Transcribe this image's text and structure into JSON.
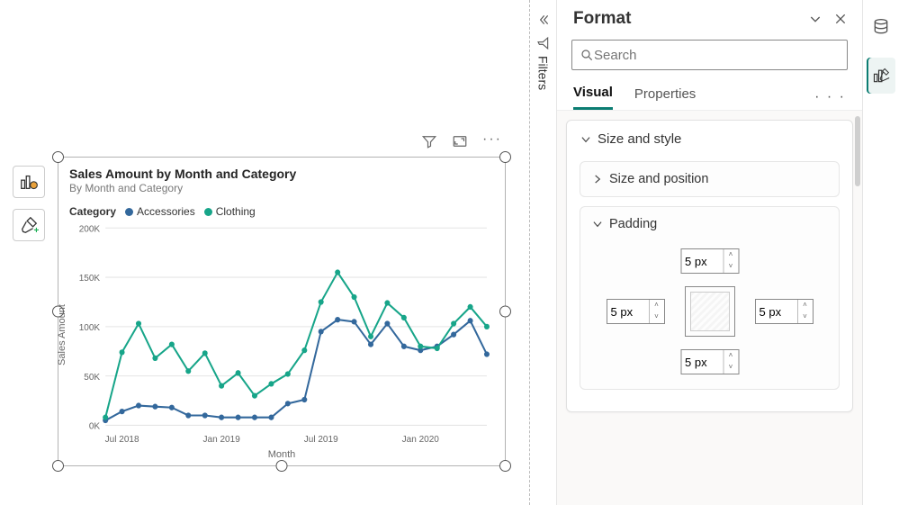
{
  "canvas": {
    "visual_toolbar": {
      "filter": "filter-icon",
      "focus": "focus-mode-icon",
      "more": "···"
    },
    "left_tools": {
      "chart_btn": "column-chart-icon",
      "format_btn": "format-paint-icon"
    }
  },
  "chart": {
    "title": "Sales Amount by Month and Category",
    "subtitle": "By Month and Category",
    "legend_label": "Category",
    "xlabel": "Month",
    "ylabel": "Sales Amount"
  },
  "chart_data": {
    "type": "line",
    "title": "Sales Amount by Month and Category",
    "xlabel": "Month",
    "ylabel": "Sales Amount",
    "ylim": [
      0,
      200000
    ],
    "y_ticks": [
      0,
      50000,
      100000,
      150000,
      200000
    ],
    "y_tick_labels": [
      "0K",
      "50K",
      "100K",
      "150K",
      "200K"
    ],
    "x_tick_labels": [
      "Jul 2018",
      "Jan 2019",
      "Jul 2019",
      "Jan 2020"
    ],
    "x_tick_indices": [
      1,
      7,
      13,
      19
    ],
    "categories": [
      "Jun 2018",
      "Jul 2018",
      "Aug 2018",
      "Sep 2018",
      "Oct 2018",
      "Nov 2018",
      "Dec 2018",
      "Jan 2019",
      "Feb 2019",
      "Mar 2019",
      "Apr 2019",
      "May 2019",
      "Jun 2019",
      "Jul 2019",
      "Aug 2019",
      "Sep 2019",
      "Oct 2019",
      "Nov 2019",
      "Dec 2019",
      "Jan 2020",
      "Feb 2020",
      "Mar 2020",
      "Apr 2020",
      "May 2020"
    ],
    "series": [
      {
        "name": "Accessories",
        "color": "#33689c",
        "values": [
          5000,
          14000,
          20000,
          19000,
          18000,
          10000,
          10000,
          8000,
          8000,
          8000,
          8000,
          22000,
          26000,
          95000,
          107000,
          105000,
          82000,
          103000,
          80000,
          76000,
          80000,
          92000,
          106000,
          72000
        ]
      },
      {
        "name": "Clothing",
        "color": "#17a589",
        "values": [
          8000,
          74000,
          103000,
          68000,
          82000,
          55000,
          73000,
          40000,
          53000,
          30000,
          42000,
          52000,
          76000,
          125000,
          155000,
          130000,
          90000,
          124000,
          109000,
          80000,
          78000,
          103000,
          120000,
          100000
        ]
      }
    ]
  },
  "filters": {
    "label": "Filters"
  },
  "format_pane": {
    "title": "Format",
    "search_placeholder": "Search",
    "tabs": {
      "visual": "Visual",
      "properties": "Properties",
      "more": "· · ·"
    },
    "cards": {
      "size_style": {
        "label": "Size and style",
        "expanded": true
      },
      "size_position": {
        "label": "Size and position",
        "expanded": false
      },
      "padding": {
        "label": "Padding",
        "expanded": true,
        "top": "5 px",
        "bottom": "5 px",
        "left": "5 px",
        "right": "5 px"
      }
    }
  },
  "right_rail": {
    "data": "data-icon",
    "format": "format-icon"
  }
}
